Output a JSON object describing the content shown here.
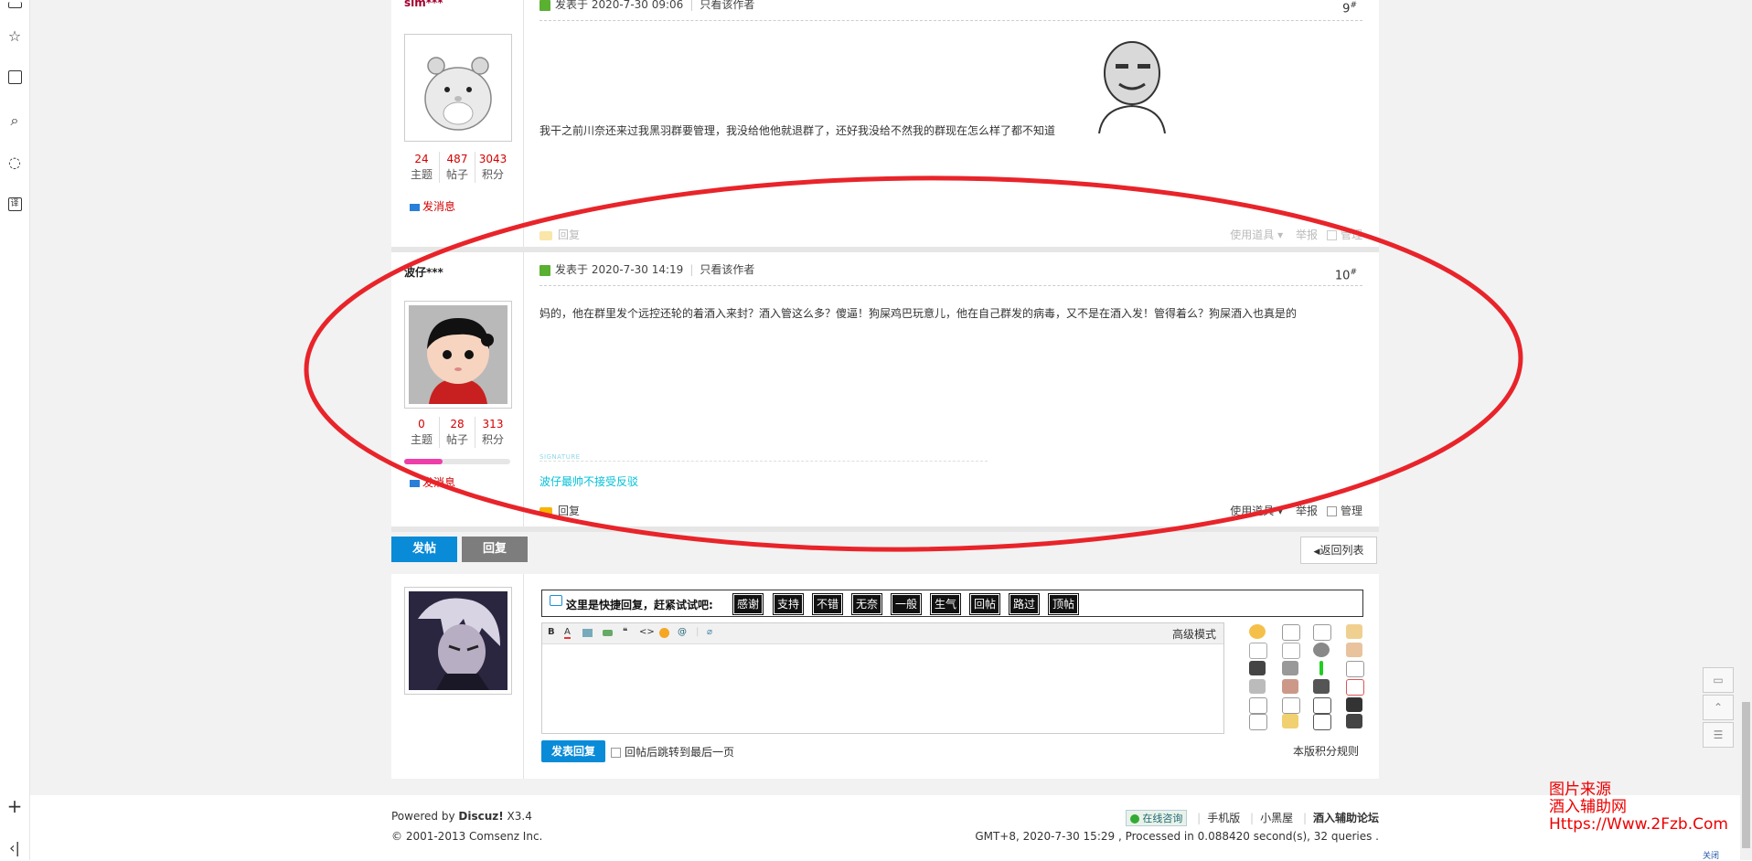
{
  "post9": {
    "author": "sim***",
    "posted": "发表于 2020-7-30 09:06",
    "author_only": "只看该作者",
    "floor": "9",
    "text": "我干之前川奈还来过我黑羽群要管理，我没给他他就退群了，还好我没给不然我的群现在怎么样了都不知道",
    "stats": [
      {
        "n": "24",
        "l": "主题"
      },
      {
        "n": "487",
        "l": "帖子"
      },
      {
        "n": "3043",
        "l": "积分"
      }
    ],
    "send_msg": "发消息",
    "reply": "回复",
    "tools": "使用道具",
    "report": "举报",
    "manage": "管理"
  },
  "post10": {
    "author": "波仔***",
    "posted": "发表于 2020-7-30 14:19",
    "author_only": "只看该作者",
    "floor": "10",
    "text": "妈的，他在群里发个远控还轮的着酒入来封？酒入管这么多？傻逼！狗屎鸡巴玩意儿，他在自己群发的病毒，又不是在酒入发！管得着么？狗屎酒入也真是的",
    "stats": [
      {
        "n": "0",
        "l": "主题"
      },
      {
        "n": "28",
        "l": "帖子"
      },
      {
        "n": "313",
        "l": "积分"
      }
    ],
    "signature_label": "SIGNATURE",
    "signature": "波仔最帅不接受反驳",
    "send_msg": "发消息",
    "reply": "回复",
    "tools": "使用道具",
    "report": "举报",
    "manage": "管理"
  },
  "actions": {
    "new_post": "发帖",
    "reply": "回复",
    "back": "返回列表"
  },
  "quick_reply": {
    "label": "这里是快捷回复，赶紧试试吧:",
    "tags": [
      "感谢",
      "支持",
      "不错",
      "无奈",
      "一般",
      "生气",
      "回帖",
      "路过",
      "顶帖"
    ],
    "advanced": "高级模式",
    "submit": "发表回复",
    "jump_last": "回帖后跳转到最后一页",
    "rules": "本版积分规则"
  },
  "footer": {
    "powered_prefix": "Powered by ",
    "powered_brand": "Discuz!",
    "powered_ver": " X3.4",
    "copyright": "© 2001-2013 Comsenz Inc.",
    "online": "在线咨询",
    "links": [
      "手机版",
      "小黑屋",
      "酒入辅助论坛"
    ],
    "stats_line": "GMT+8, 2020-7-30 15:29 , Processed in 0.088420 second(s), 32 queries ."
  },
  "watermark": {
    "line1": "图片来源",
    "line2": "酒入辅助网",
    "line3": "Https://Www.2Fzb.Com",
    "close": "关闭"
  },
  "colors": {
    "accent_blue": "#0a8bd8",
    "gray_btn": "#7d7d7d",
    "red_num": "#d40000",
    "annotation_red": "#e8242a",
    "signature_cyan": "#00c2d8"
  }
}
